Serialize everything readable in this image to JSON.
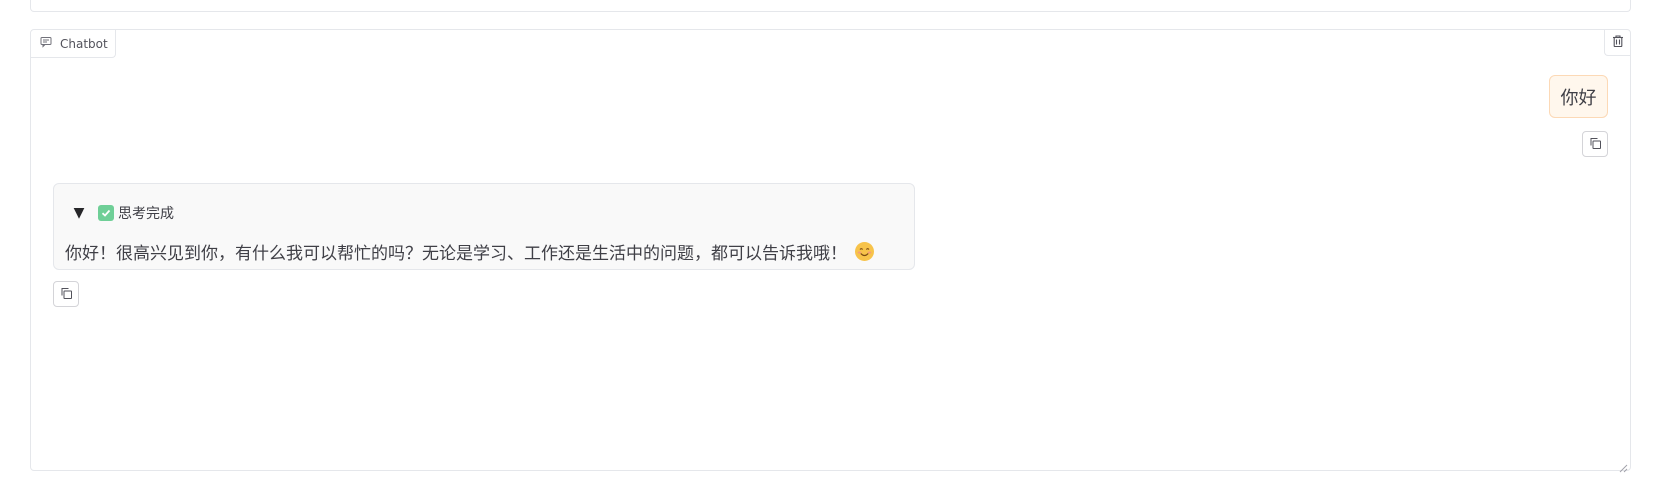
{
  "chatbot": {
    "label": "Chatbot",
    "label_icon": "chat-icon",
    "delete_icon": "trash-icon",
    "messages": [
      {
        "role": "user",
        "text": "你好"
      },
      {
        "role": "bot",
        "thinking": {
          "status": "思考完成",
          "collapsed_indicator": "▼"
        },
        "text": "你好！很高兴见到你，有什么我可以帮忙的吗？无论是学习、工作还是生活中的问题，都可以告诉我哦！"
      }
    ]
  },
  "colors": {
    "user_bubble_bg": "#fff7ed",
    "user_bubble_border": "#fcd9b6",
    "bot_bubble_bg": "#f9f9f9",
    "check_green": "#6fcf97"
  }
}
